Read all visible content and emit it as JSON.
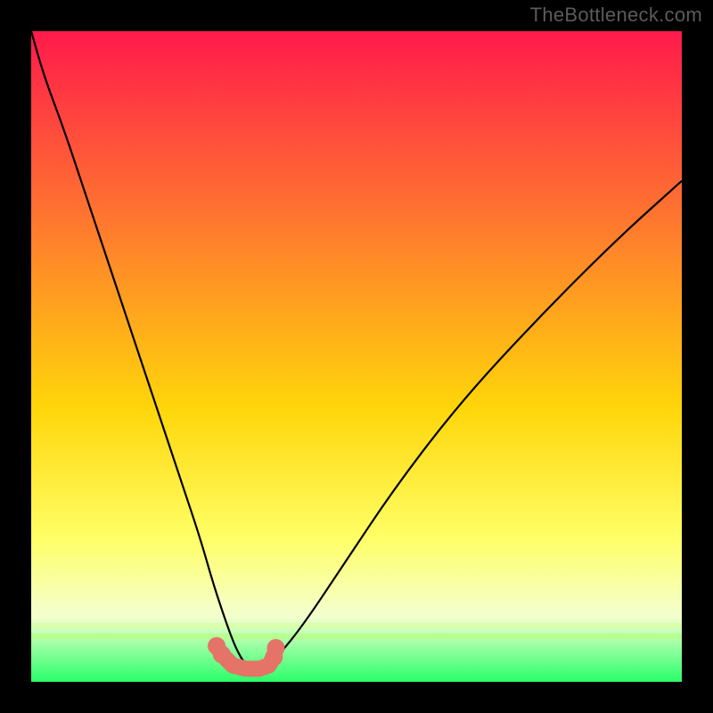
{
  "watermark": "TheBottleneck.com",
  "colors": {
    "frame": "#000000",
    "gradient_top": "#ff1a4b",
    "gradient_mid1": "#ff7a2e",
    "gradient_mid2": "#ffd60a",
    "gradient_mid3": "#ffff66",
    "gradient_band": "#f4ffd0",
    "gradient_bottom": "#2aff6a",
    "curve": "#000000",
    "marker_fill": "#e57368",
    "marker_stroke": "#c84f46"
  },
  "chart_data": {
    "type": "line",
    "title": "",
    "xlabel": "",
    "ylabel": "",
    "xlim": [
      0,
      100
    ],
    "ylim": [
      0,
      100
    ],
    "min_x": 33,
    "series": [
      {
        "name": "bottleneck-curve",
        "x": [
          0,
          2,
          5,
          8,
          11,
          14,
          17,
          20,
          23,
          26,
          28,
          30,
          31.5,
          33,
          34.5,
          36,
          38,
          42,
          48,
          56,
          66,
          78,
          90,
          100
        ],
        "y": [
          100,
          93,
          85,
          76,
          67,
          58,
          49,
          40,
          31,
          22,
          15,
          9,
          5,
          2.5,
          2,
          2.5,
          4,
          9,
          18,
          30,
          43,
          56,
          68,
          77
        ]
      }
    ],
    "markers": {
      "name": "highlight-region",
      "x": [
        28.5,
        29.3,
        31,
        33,
        35,
        36.5,
        37.3,
        37.6
      ],
      "y": [
        5.5,
        4.2,
        2.5,
        2,
        2,
        2.5,
        3.8,
        5.2
      ]
    }
  }
}
